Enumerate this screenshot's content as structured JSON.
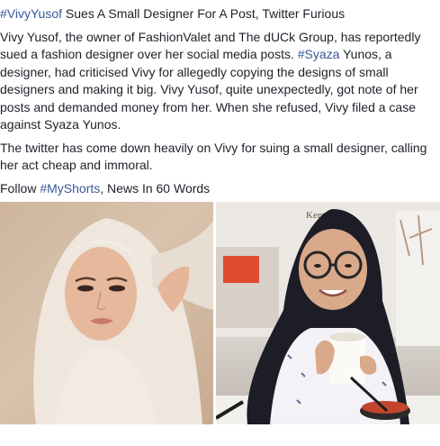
{
  "post": {
    "title_hashtag": "#VivyYusof",
    "title_rest": " Sues A Small Designer For A Post, Twitter Furious",
    "para1_before": "Vivy Yusof, the owner of FashionValet and The dUCk Group, has reportedly sued a fashion designer over her social media posts. ",
    "para1_hashtag": "#Syaza",
    "para1_after": " Yunos, a designer, had criticised Vivy for allegedly copying the designs of small designers and making it big. Vivy Yusof, quite unexpectedly, got note of her posts and demanded money from her. When she refused, Vivy filed a case against Syaza Yunos.",
    "para2": "The twitter has come down heavily on Vivy for suing a small designer, calling her act cheap and immoral.",
    "follow_before": "Follow ",
    "follow_hashtag": "#MyShorts",
    "follow_after": ", News In 60 Words"
  },
  "photos": {
    "left": {
      "description_icon": "woman-in-hijab-portrait"
    },
    "right": {
      "description_icon": "woman-in-hijab-with-cup",
      "sign_text": "Kentai"
    }
  },
  "colors": {
    "text": "#1d2129",
    "link": "#365899",
    "background": "#ffffff"
  }
}
